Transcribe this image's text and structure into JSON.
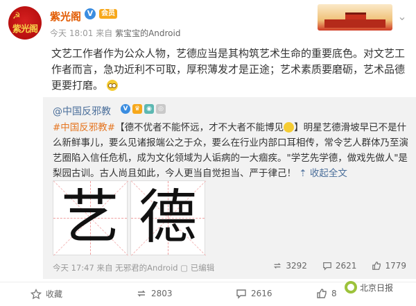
{
  "header": {
    "author": "紫光阁",
    "verified_mark": "V",
    "vip_mark": "会员",
    "avatar_text": "紫光阁",
    "meta_time": "今天 18:01",
    "meta_from": "来自",
    "meta_source": "紫宝宝的Android"
  },
  "post": {
    "text": "文艺工作者作为公众人物，艺德应当是其构筑艺术生命的重要底色。对文艺工作者而言，急功近利不可取，厚积薄发才是正途；艺术素质要磨砺，艺术品德更要打磨。"
  },
  "repost": {
    "author": "@中国反邪教",
    "hashtag": "#中国反邪教#",
    "text_before_emoji": "【德不优者不能怀远，才不大者不能博见",
    "text_after_emoji": "】明星艺德滑坡早已不是什么新鲜事儿，要么见诸报端公之于众，要么在行业内部口耳相传，常令艺人群体乃至演艺圈陷入信任危机，成为文化领域为人诟病的一大痼疾。\"学艺先学德，做戏先做人\"是梨园古训。古人尚且如此，今人更当自觉担当、严于律己！",
    "more_link": "收起全文",
    "image1_char": "艺",
    "image2_char": "德",
    "meta_time": "今天 17:47",
    "meta_from": "来自",
    "meta_source": "无邪君的Android",
    "meta_edited": "已编辑",
    "reposts": "3292",
    "comments": "2621",
    "likes": "1779"
  },
  "actions": {
    "repost_label": "收藏",
    "repost_count": "2803",
    "comment_count": "2616",
    "like_count": "8"
  },
  "watermark": "北京日报",
  "colors": {
    "author": "#e25a00",
    "link": "#4a6e9a",
    "hashtag": "#e57520",
    "repost_bg": "#f2f2f2"
  }
}
